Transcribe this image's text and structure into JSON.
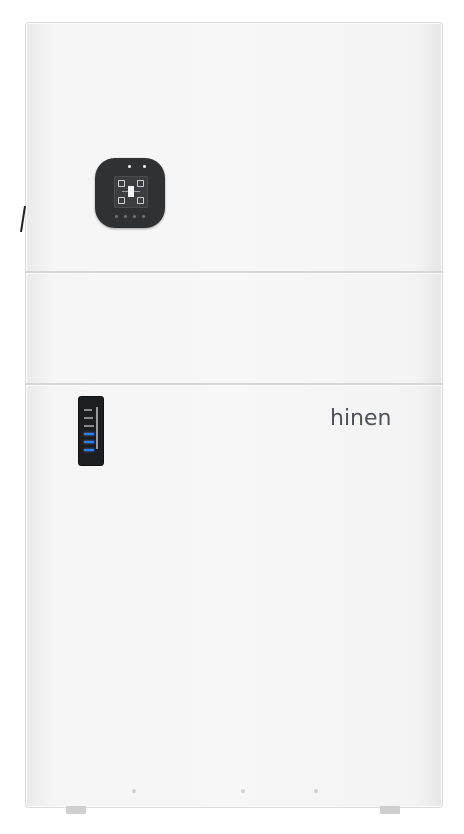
{
  "product": {
    "brand_logo_text": "hinen",
    "soc_levels_total": 6,
    "soc_levels_lit": 3,
    "colors": {
      "body": "#f5f5f5",
      "display": "#2f3133",
      "indicator_on": "#2f7cff",
      "indicator_off": "#888888",
      "logo": "#4f5256"
    }
  }
}
